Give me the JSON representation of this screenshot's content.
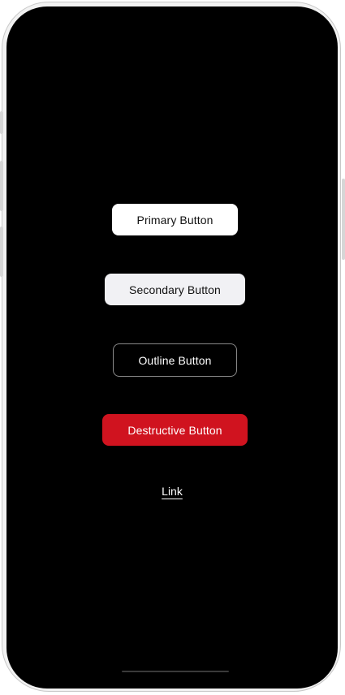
{
  "buttons": {
    "primary_label": "Primary Button",
    "secondary_label": "Secondary Button",
    "outline_label": "Outline Button",
    "destructive_label": "Destructive Button"
  },
  "link": {
    "label": "Link"
  },
  "colors": {
    "screen_background": "#000000",
    "primary_background": "#ffffff",
    "secondary_background": "#f1f1f4",
    "destructive_background": "#d0131f",
    "outline_border": "#8a8a8a"
  }
}
